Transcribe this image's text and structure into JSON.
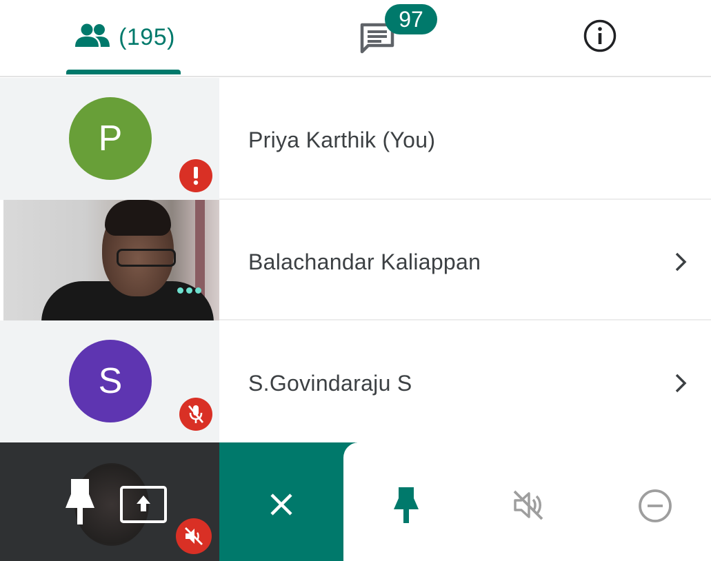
{
  "tabs": {
    "people": {
      "icon": "people-icon",
      "count_label": "(195)"
    },
    "chat": {
      "icon": "chat-icon",
      "badge": "97"
    },
    "info": {
      "icon": "info-icon"
    }
  },
  "participants": [
    {
      "name": "Priya Karthik (You)",
      "avatar_letter": "P",
      "avatar_color": "#689f38",
      "status_icon": "alert-icon"
    },
    {
      "name": "Balachandar Kaliappan",
      "video": true,
      "status_icon": "speaking-dots-icon"
    },
    {
      "name": "S.Govindaraju S",
      "avatar_letter": "S",
      "avatar_color": "#5e35b1",
      "status_icon": "mic-off-icon"
    }
  ],
  "action_bar": {
    "self_view_icons": [
      "pin-icon",
      "present-screen-icon",
      "volume-off-icon"
    ],
    "close_icon": "close-icon",
    "options": [
      "pin-icon",
      "mute-icon",
      "remove-icon"
    ]
  },
  "colors": {
    "accent": "#00796b",
    "alert": "#d93025",
    "text": "#3c4043",
    "muted_icon": "#9e9e9e"
  }
}
